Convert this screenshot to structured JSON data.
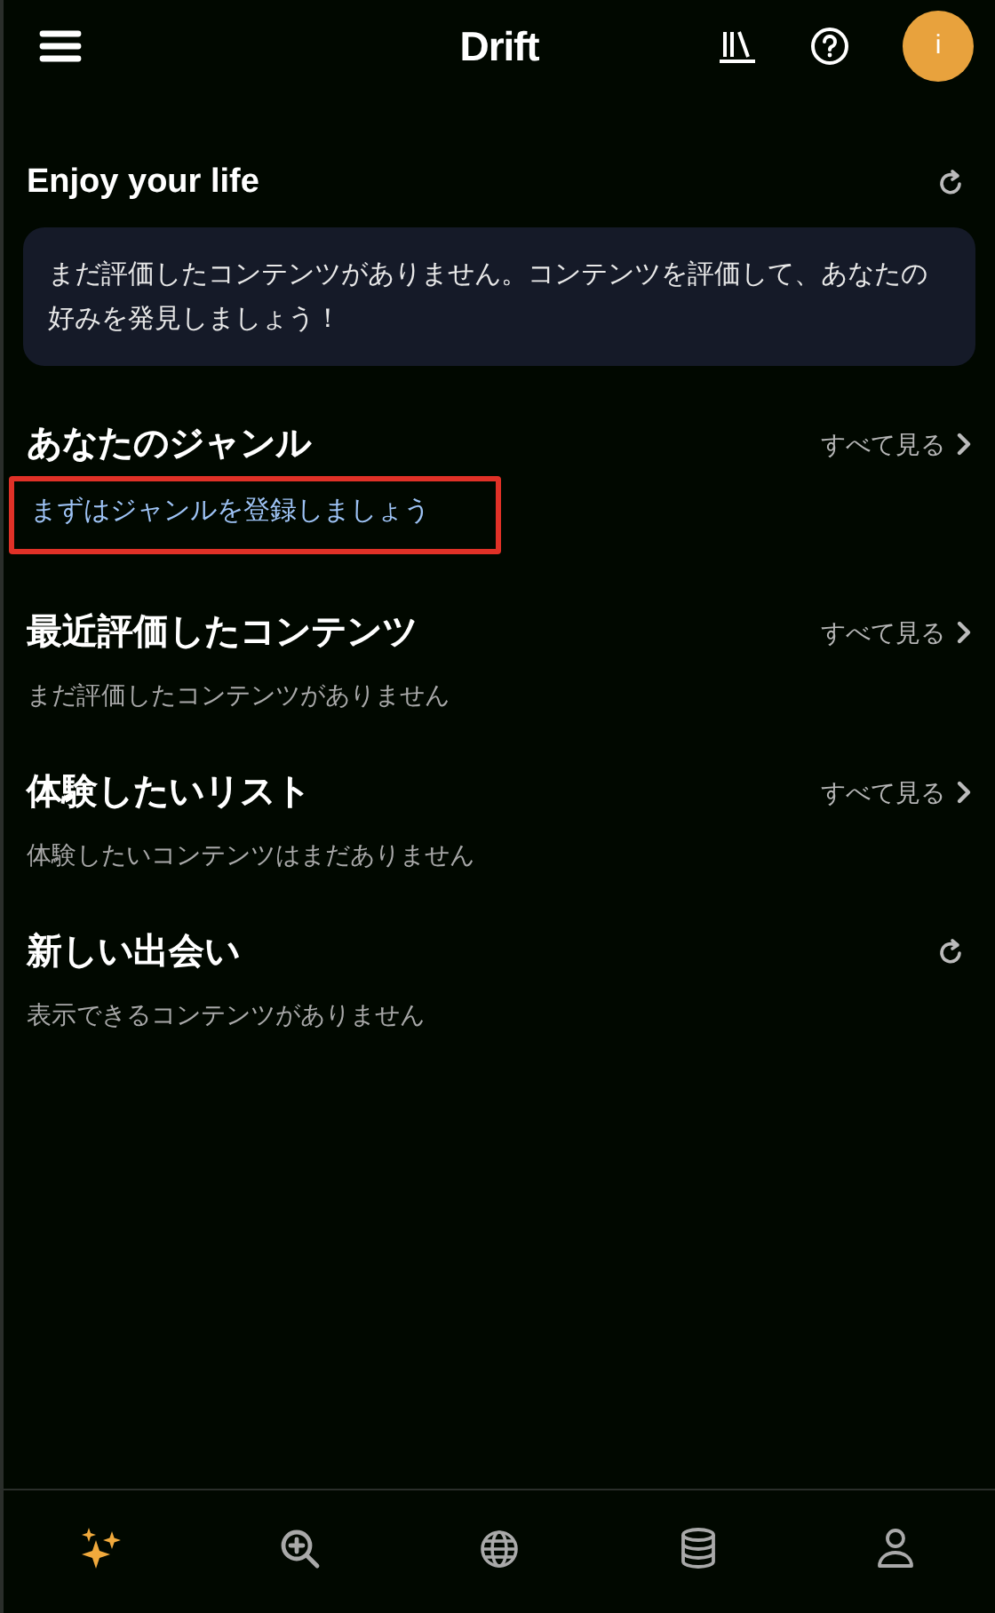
{
  "header": {
    "title": "Drift",
    "avatar": "i"
  },
  "sections": [
    {
      "title": "Enjoy your life",
      "action": {
        "kind": "refresh"
      },
      "body": {
        "kind": "card",
        "text": "まだ評価したコンテンツがありません。コンテンツを評価して、あなたの好みを発見しましょう！"
      }
    },
    {
      "title": "あなたのジャンル",
      "action": {
        "kind": "see_all",
        "label": "すべて見る"
      },
      "body": {
        "kind": "link",
        "text": "まずはジャンルを登録しましょう",
        "highlighted": true
      }
    },
    {
      "title": "最近評価したコンテンツ",
      "action": {
        "kind": "see_all",
        "label": "すべて見る"
      },
      "body": {
        "kind": "note",
        "text": "まだ評価したコンテンツがありません"
      }
    },
    {
      "title": "体験したいリスト",
      "action": {
        "kind": "see_all",
        "label": "すべて見る"
      },
      "body": {
        "kind": "note",
        "text": "体験したいコンテンツはまだありません"
      }
    },
    {
      "title": "新しい出会い",
      "action": {
        "kind": "refresh"
      },
      "body": {
        "kind": "note",
        "text": "表示できるコンテンツがありません"
      }
    }
  ],
  "nav": [
    {
      "kind": "discover",
      "selected": true
    },
    {
      "kind": "search",
      "selected": false
    },
    {
      "kind": "globe",
      "selected": false
    },
    {
      "kind": "database",
      "selected": false
    },
    {
      "kind": "profile",
      "selected": false
    }
  ]
}
